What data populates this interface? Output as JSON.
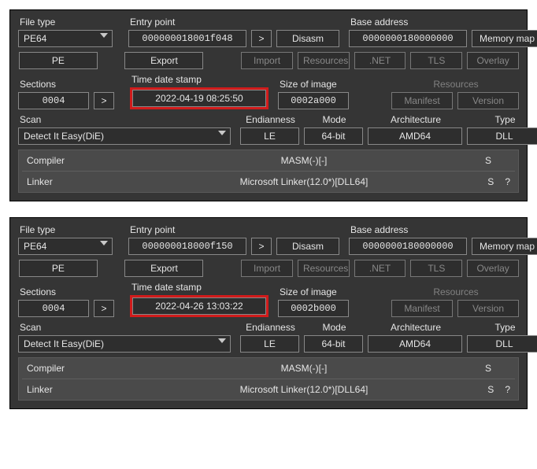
{
  "panels": [
    {
      "file_type_label": "File type",
      "file_type_value": "PE64",
      "entry_point_label": "Entry point",
      "entry_point_value": "000000018001f048",
      "gt_label": ">",
      "disasm_label": "Disasm",
      "base_addr_label": "Base address",
      "base_addr_value": "0000000180000000",
      "memmap_label": "Memory map",
      "pe_label": "PE",
      "export_label": "Export",
      "import_label": "Import",
      "resources_label": "Resources",
      "net_label": ".NET",
      "tls_label": "TLS",
      "overlay_label": "Overlay",
      "sections_label": "Sections",
      "sections_value": "0004",
      "sections_gt": ">",
      "tds_label": "Time date stamp",
      "tds_value": "2022-04-19 08:25:50",
      "soi_label": "Size of image",
      "soi_value": "0002a000",
      "res_group_label": "Resources",
      "manifest_label": "Manifest",
      "version_label": "Version",
      "scan_label": "Scan",
      "scan_value": "Detect It Easy(DiE)",
      "end_label": "Endianness",
      "end_value": "LE",
      "mode_label": "Mode",
      "mode_value": "64-bit",
      "arch_label": "Architecture",
      "arch_value": "AMD64",
      "type_label": "Type",
      "type_value": "DLL",
      "info_compiler_label": "Compiler",
      "info_compiler_value": "MASM(-)[-]",
      "info_compiler_r1": "S",
      "info_linker_label": "Linker",
      "info_linker_value": "Microsoft Linker(12.0*)[DLL64]",
      "info_linker_r1": "S",
      "info_linker_r2": "?"
    },
    {
      "file_type_label": "File type",
      "file_type_value": "PE64",
      "entry_point_label": "Entry point",
      "entry_point_value": "000000018000f150",
      "gt_label": ">",
      "disasm_label": "Disasm",
      "base_addr_label": "Base address",
      "base_addr_value": "0000000180000000",
      "memmap_label": "Memory map",
      "pe_label": "PE",
      "export_label": "Export",
      "import_label": "Import",
      "resources_label": "Resources",
      "net_label": ".NET",
      "tls_label": "TLS",
      "overlay_label": "Overlay",
      "sections_label": "Sections",
      "sections_value": "0004",
      "sections_gt": ">",
      "tds_label": "Time date stamp",
      "tds_value": "2022-04-26 13:03:22",
      "soi_label": "Size of image",
      "soi_value": "0002b000",
      "res_group_label": "Resources",
      "manifest_label": "Manifest",
      "version_label": "Version",
      "scan_label": "Scan",
      "scan_value": "Detect It Easy(DiE)",
      "end_label": "Endianness",
      "end_value": "LE",
      "mode_label": "Mode",
      "mode_value": "64-bit",
      "arch_label": "Architecture",
      "arch_value": "AMD64",
      "type_label": "Type",
      "type_value": "DLL",
      "info_compiler_label": "Compiler",
      "info_compiler_value": "MASM(-)[-]",
      "info_compiler_r1": "S",
      "info_linker_label": "Linker",
      "info_linker_value": "Microsoft Linker(12.0*)[DLL64]",
      "info_linker_r1": "S",
      "info_linker_r2": "?"
    }
  ]
}
